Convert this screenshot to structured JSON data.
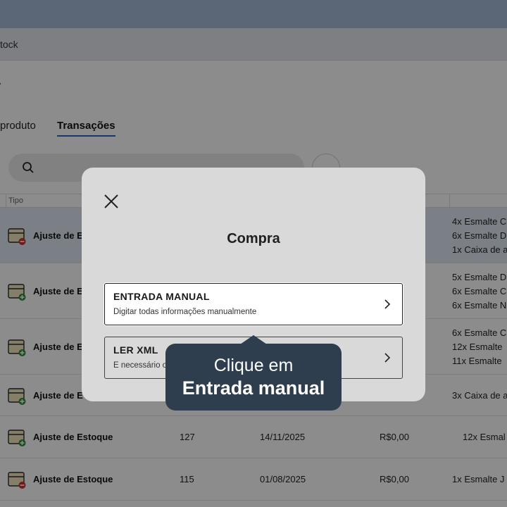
{
  "browser": {
    "address": "tock"
  },
  "tabs": [
    {
      "label": "produto"
    },
    {
      "label": "Transações"
    }
  ],
  "search": {
    "placeholder": ""
  },
  "table": {
    "header_tipo": "Tipo",
    "rows": [
      {
        "tipo": "Ajuste de E",
        "status": "minus",
        "num": "",
        "date": "",
        "value": "",
        "items": [
          "4x Esmalte C",
          "6x Esmalte D",
          "1x Caixa de a"
        ],
        "selected": true
      },
      {
        "tipo": "Ajuste de E",
        "status": "plus",
        "num": "",
        "date": "",
        "value": "",
        "items": [
          "5x Esmalte D",
          "6x Esmalte C",
          "6x Esmalte N"
        ]
      },
      {
        "tipo": "Ajuste de E",
        "status": "plus",
        "num": "",
        "date": "",
        "value": "",
        "items": [
          "6x Esmalte C",
          "12x Esmalte",
          "11x Esmalte"
        ]
      },
      {
        "tipo": "Ajuste de E",
        "status": "plus",
        "num": "",
        "date": "",
        "value": "",
        "items": [
          "3x Caixa de a"
        ]
      },
      {
        "tipo": "Ajuste de Estoque",
        "status": "plus",
        "num": "127",
        "date": "14/11/2025",
        "value": "R$0,00",
        "items": [
          "12x Esmal"
        ]
      },
      {
        "tipo": "Ajuste de Estoque",
        "status": "minus",
        "num": "115",
        "date": "01/08/2025",
        "value": "R$0,00",
        "items": [
          "1x Esmalte J"
        ]
      }
    ]
  },
  "modal": {
    "title": "Compra",
    "options": [
      {
        "title": "ENTRADA MANUAL",
        "description": "Digitar todas informações manualmente"
      },
      {
        "title": "LER XML",
        "description": "É necessário o"
      }
    ]
  },
  "tooltip": {
    "line1": "Clique em",
    "line2": "Entrada manual"
  },
  "colors": {
    "accent": "#2a64c7",
    "tooltip_bg": "#2e3e4f",
    "status_minus": "#d32f2f",
    "status_plus": "#2e8b3a"
  }
}
